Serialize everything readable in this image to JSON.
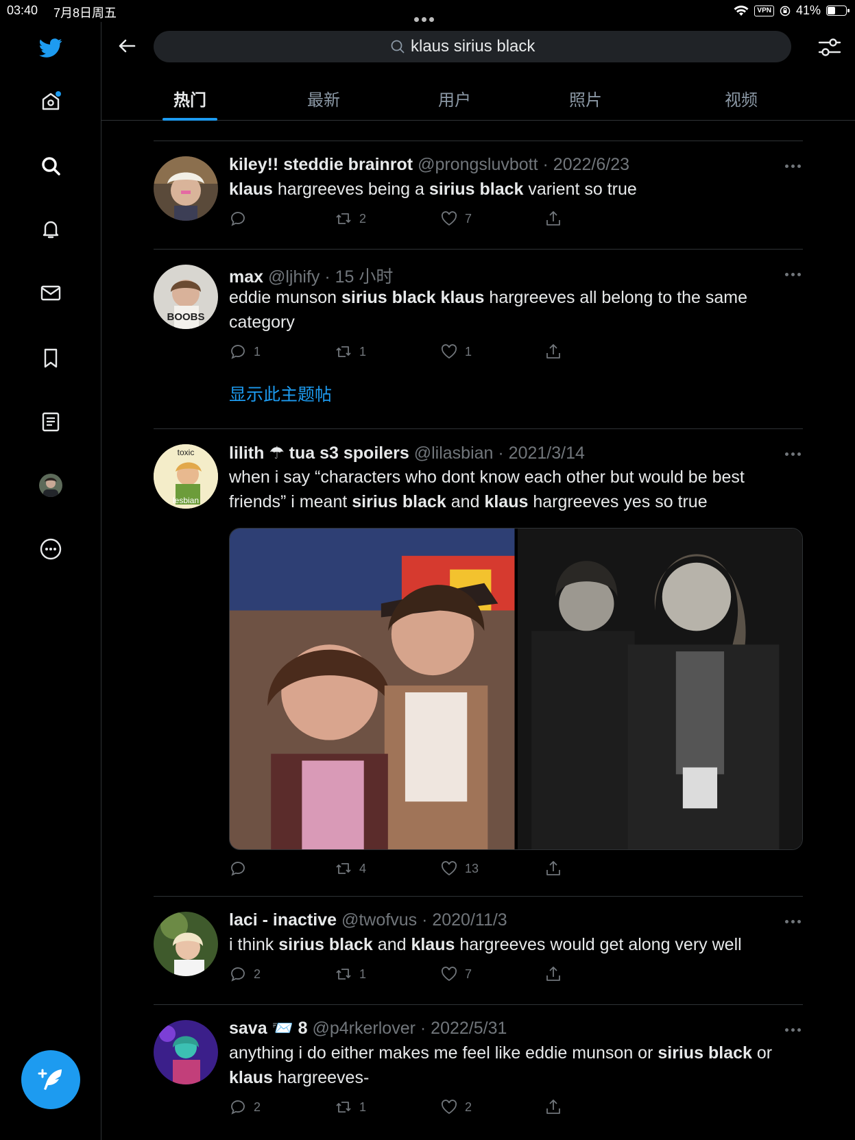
{
  "status_bar": {
    "time": "03:40",
    "date": "7月8日周五",
    "vpn": "VPN",
    "battery_percent_label": "41%",
    "battery_level": 0.41
  },
  "search": {
    "query": "klaus sirius black"
  },
  "tabs": [
    {
      "label": "热门",
      "active": true
    },
    {
      "label": "最新",
      "active": false
    },
    {
      "label": "用户",
      "active": false
    },
    {
      "label": "照片",
      "active": false
    },
    {
      "label": "视频",
      "active": false
    }
  ],
  "tweets": [
    {
      "name": "kiley!! steddie brainrot",
      "handle": "@prongsluvbott",
      "time": "· 2022/6/23",
      "text_html": "<b>klaus</b> hargreeves being a <b>sirius black</b> varient so true",
      "replies": "",
      "retweets": "2",
      "likes": "7"
    },
    {
      "name": "max",
      "handle": "@ljhify",
      "time": "· 15 小时",
      "text_html": "eddie munson <b>sirius black klaus</b> hargreeves all belong to the same category",
      "replies": "1",
      "retweets": "1",
      "likes": "1",
      "thread_link": "显示此主题帖"
    },
    {
      "name": "lilith ☂ tua s3 spoilers",
      "handle": "@lilasbian",
      "time": "· 2021/3/14",
      "text_html": "when i say “characters who dont know each other but would be best friends” i meant <b>sirius black</b> and <b>klaus</b> hargreeves yes so true",
      "replies": "",
      "retweets": "4",
      "likes": "13",
      "avatar_text_top": "toxic",
      "avatar_text_bottom": "lesbian"
    },
    {
      "name": "laci - inactive",
      "handle": "@twofvus",
      "time": "· 2020/11/3",
      "text_html": "i think <b>sirius black</b> and <b>klaus</b> hargreeves would get along very well",
      "replies": "2",
      "retweets": "1",
      "likes": "7"
    },
    {
      "name": "sava 📨 8",
      "handle": "@p4rkerlover",
      "time": "· 2022/5/31",
      "text_html": "anything i do either makes me feel like eddie munson or <b>sirius black</b> or <b>klaus</b> hargreeves-",
      "replies": "2",
      "retweets": "1",
      "likes": "2"
    }
  ],
  "avatar_caption_max": "BOOBS",
  "colors": {
    "accent": "#1d9bf0",
    "background": "#000000",
    "muted": "#71767b",
    "divider": "#2f3336"
  }
}
